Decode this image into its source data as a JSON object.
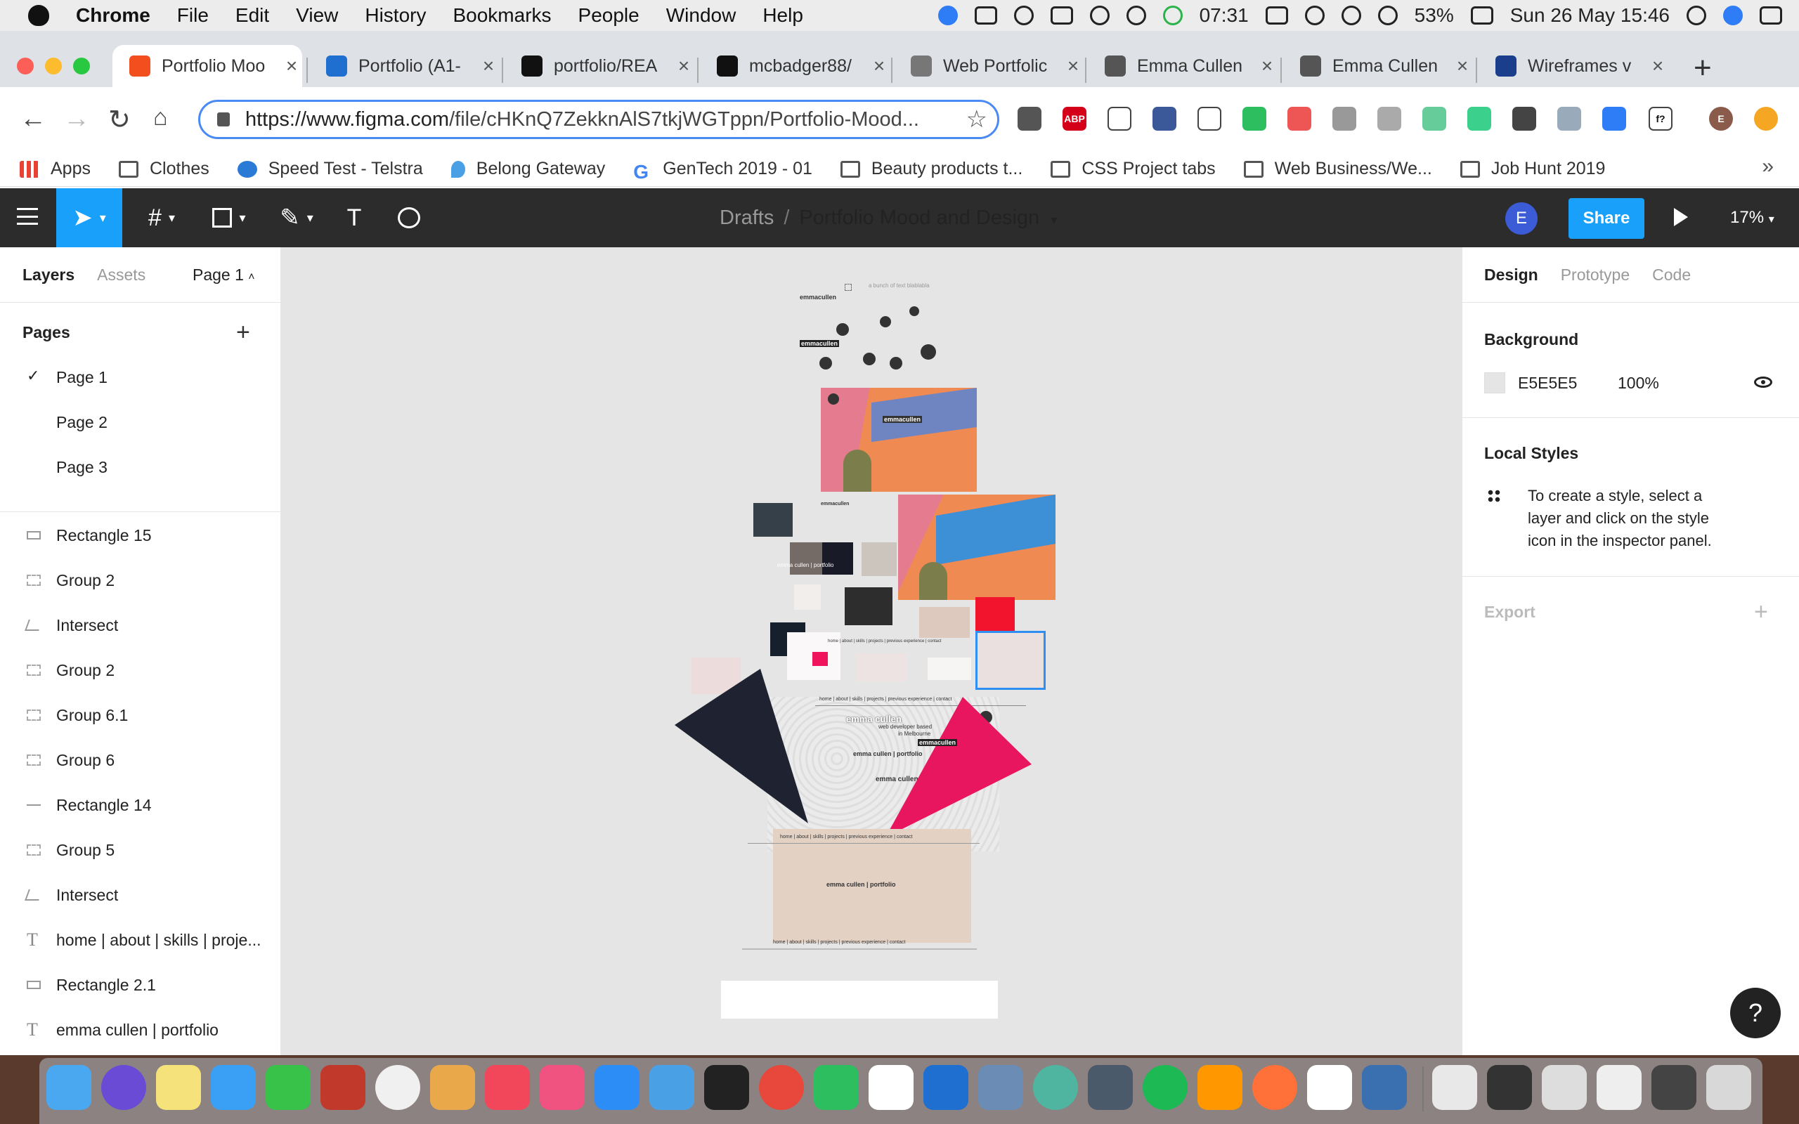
{
  "menubar": {
    "app": "Chrome",
    "items": [
      "File",
      "Edit",
      "View",
      "History",
      "Bookmarks",
      "People",
      "Window",
      "Help"
    ],
    "clock_small": "07:31",
    "battery": "53%",
    "datetime": "Sun 26 May  15:46"
  },
  "tabs": [
    {
      "label": "Portfolio Moo",
      "color": "#f24e1e"
    },
    {
      "label": "Portfolio (A1-",
      "color": "#1f6fd1"
    },
    {
      "label": "portfolio/REA",
      "color": "#111111"
    },
    {
      "label": "mcbadger88/",
      "color": "#111111"
    },
    {
      "label": "Web Portfolic",
      "color": "#777777"
    },
    {
      "label": "Emma Cullen",
      "color": "#555555"
    },
    {
      "label": "Emma Cullen",
      "color": "#555555"
    },
    {
      "label": "Wireframes v",
      "color": "#1a3e8c"
    }
  ],
  "omnibox": {
    "url_host": "https://www.figma.com",
    "url_path": "/file/cHKnQ7ZekknAlS7tkjWGTppn/Portfolio-Mood..."
  },
  "extensions": {
    "abp": "ABP",
    "fx": "f?",
    "profile": "E"
  },
  "bookmarks": [
    {
      "label": "Apps",
      "icon": "apps-grid-icon"
    },
    {
      "label": "Clothes",
      "icon": "folder-icon"
    },
    {
      "label": "Speed Test - Telstra",
      "icon": "telstra-icon"
    },
    {
      "label": "Belong Gateway",
      "icon": "location-pin-icon"
    },
    {
      "label": "GenTech 2019 - 01",
      "icon": "google-icon"
    },
    {
      "label": "Beauty products t...",
      "icon": "folder-icon"
    },
    {
      "label": "CSS Project tabs",
      "icon": "folder-icon"
    },
    {
      "label": "Web Business/We...",
      "icon": "folder-icon"
    },
    {
      "label": "Job Hunt 2019",
      "icon": "folder-icon"
    }
  ],
  "bookmarks_more": "»",
  "figma": {
    "breadcrumb_root": "Drafts",
    "breadcrumb_sep": "/",
    "file_name": "Portfolio Mood and Design",
    "avatar": "E",
    "share": "Share",
    "zoom": "17%",
    "text_tool": "T"
  },
  "left_panel": {
    "tabs": [
      "Layers",
      "Assets"
    ],
    "current_page": "Page 1",
    "pages_heading": "Pages",
    "pages": [
      "Page 1",
      "Page 2",
      "Page 3"
    ],
    "layers": [
      {
        "name": "Rectangle 15",
        "icon": "rect"
      },
      {
        "name": "Group 2",
        "icon": "frame"
      },
      {
        "name": "Intersect",
        "icon": "shape"
      },
      {
        "name": "Group 2",
        "icon": "frame"
      },
      {
        "name": "Group 6.1",
        "icon": "frame"
      },
      {
        "name": "Group 6",
        "icon": "frame"
      },
      {
        "name": "Rectangle 14",
        "icon": "line"
      },
      {
        "name": "Group 5",
        "icon": "frame"
      },
      {
        "name": "Intersect",
        "icon": "shape"
      },
      {
        "name": "home | about | skills | proje...",
        "icon": "text"
      },
      {
        "name": "Rectangle 2.1",
        "icon": "rect"
      },
      {
        "name": "emma cullen | portfolio",
        "icon": "text"
      }
    ]
  },
  "canvas": {
    "background": "#E5E5E5",
    "texts": {
      "logo": "emmacullen",
      "logo2": "emmacullen",
      "tagline": "a bunch of text blablabla",
      "logo_on_photo": "emmacullen",
      "small_logo": "emmacullen",
      "swatch_label": "emma cullen | portfolio",
      "nav1": "home | about | skills | projects | previous experience | contact",
      "nav2": "home | about | skills | projects | previous experience | contact",
      "name_big": "emma cullen",
      "sub1": "web developer based",
      "sub2": "in Melbourne",
      "ec_portfolio1": "emma cullen | portfolio",
      "ec_small": "emma cullen",
      "logo_pink": "emmacullen",
      "nav3": "home | about | skills | projects | previous experience | contact",
      "ec_portfolio2": "emma cullen | portfolio",
      "nav4": "home | about | skills | projects | previous experience | contact"
    }
  },
  "right_panel": {
    "tabs": [
      "Design",
      "Prototype",
      "Code"
    ],
    "background_heading": "Background",
    "bg_hex": "E5E5E5",
    "bg_opacity": "100%",
    "local_styles_heading": "Local Styles",
    "local_styles_help": "To create a style, select a layer and click on the style icon in the inspector panel.",
    "export_heading": "Export",
    "help": "?"
  }
}
